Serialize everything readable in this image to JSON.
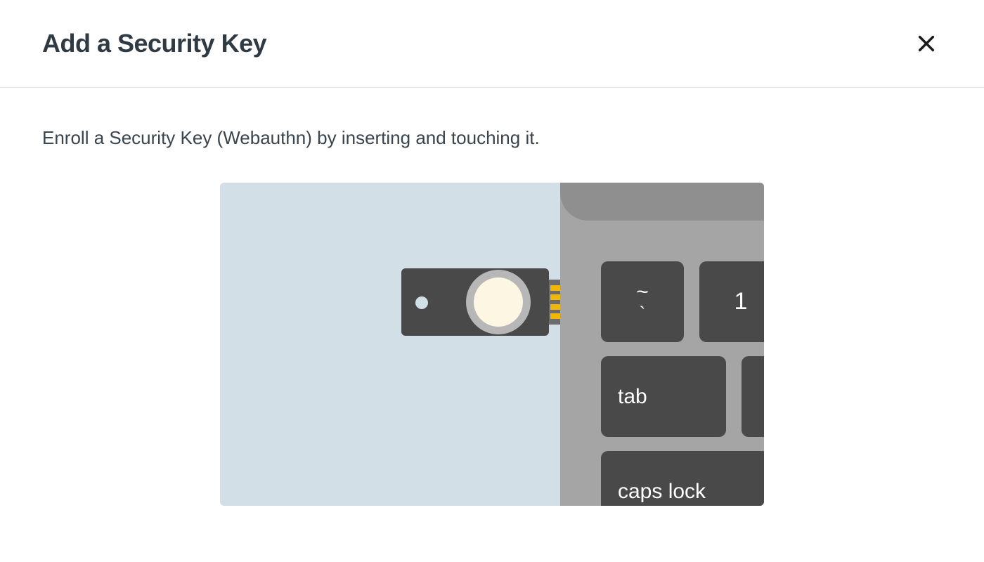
{
  "header": {
    "title": "Add a Security Key"
  },
  "body": {
    "instruction": "Enroll a Security Key (Webauthn) by inserting and touching it."
  },
  "illustration": {
    "keys": {
      "tilde_top": "~",
      "tilde_bottom": "`",
      "one": "1",
      "tab": "tab",
      "caps": "caps lock"
    }
  }
}
